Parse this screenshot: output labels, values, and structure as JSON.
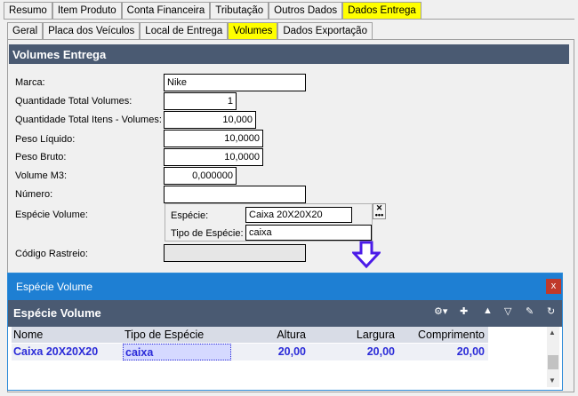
{
  "top_tabs": [
    "Resumo",
    "Item Produto",
    "Conta Financeira",
    "Tributação",
    "Outros Dados",
    "Dados Entrega"
  ],
  "sub_tabs": [
    "Geral",
    "Placa dos Veículos",
    "Local de Entrega",
    "Volumes",
    "Dados Exportação"
  ],
  "section_title": "Volumes Entrega",
  "fields": {
    "marca": {
      "label": "Marca:",
      "value": "Nike"
    },
    "qtd_volumes": {
      "label": "Quantidade Total Volumes:",
      "value": "1"
    },
    "qtd_itens": {
      "label": "Quantidade Total Itens - Volumes:",
      "value": "10,000"
    },
    "peso_liquido": {
      "label": "Peso Líquido:",
      "value": "10,0000"
    },
    "peso_bruto": {
      "label": "Peso Bruto:",
      "value": "10,0000"
    },
    "volume_m3": {
      "label": "Volume M3:",
      "value": "0,000000"
    },
    "numero": {
      "label": "Número:",
      "value": ""
    },
    "especie_volume": {
      "label": "Espécie Volume:"
    },
    "codigo_rastreio": {
      "label": "Código Rastreio:",
      "value": ""
    }
  },
  "species": {
    "especie_label": "Espécie:",
    "especie_value": "Caixa 20X20X20",
    "tipo_label": "Tipo de Espécie:",
    "tipo_value": "caixa",
    "button_glyph": "✕\n•••"
  },
  "dialog": {
    "title": "Espécie Volume",
    "close": "x",
    "subtitle": "Espécie Volume",
    "columns": [
      "Nome",
      "Tipo de Espécie",
      "Altura",
      "Largura",
      "Comprimento"
    ],
    "rows": [
      {
        "nome": "Caixa 20X20X20",
        "tipo": "caixa",
        "altura": "20,00",
        "largura": "20,00",
        "comprimento": "20,00"
      }
    ]
  },
  "colors": {
    "active_tab": "#ffff00",
    "header": "#4a5a72",
    "dialog_title": "#1e7fd3",
    "highlight_text": "#2b2bd8",
    "arrow": "#4b1be8"
  }
}
